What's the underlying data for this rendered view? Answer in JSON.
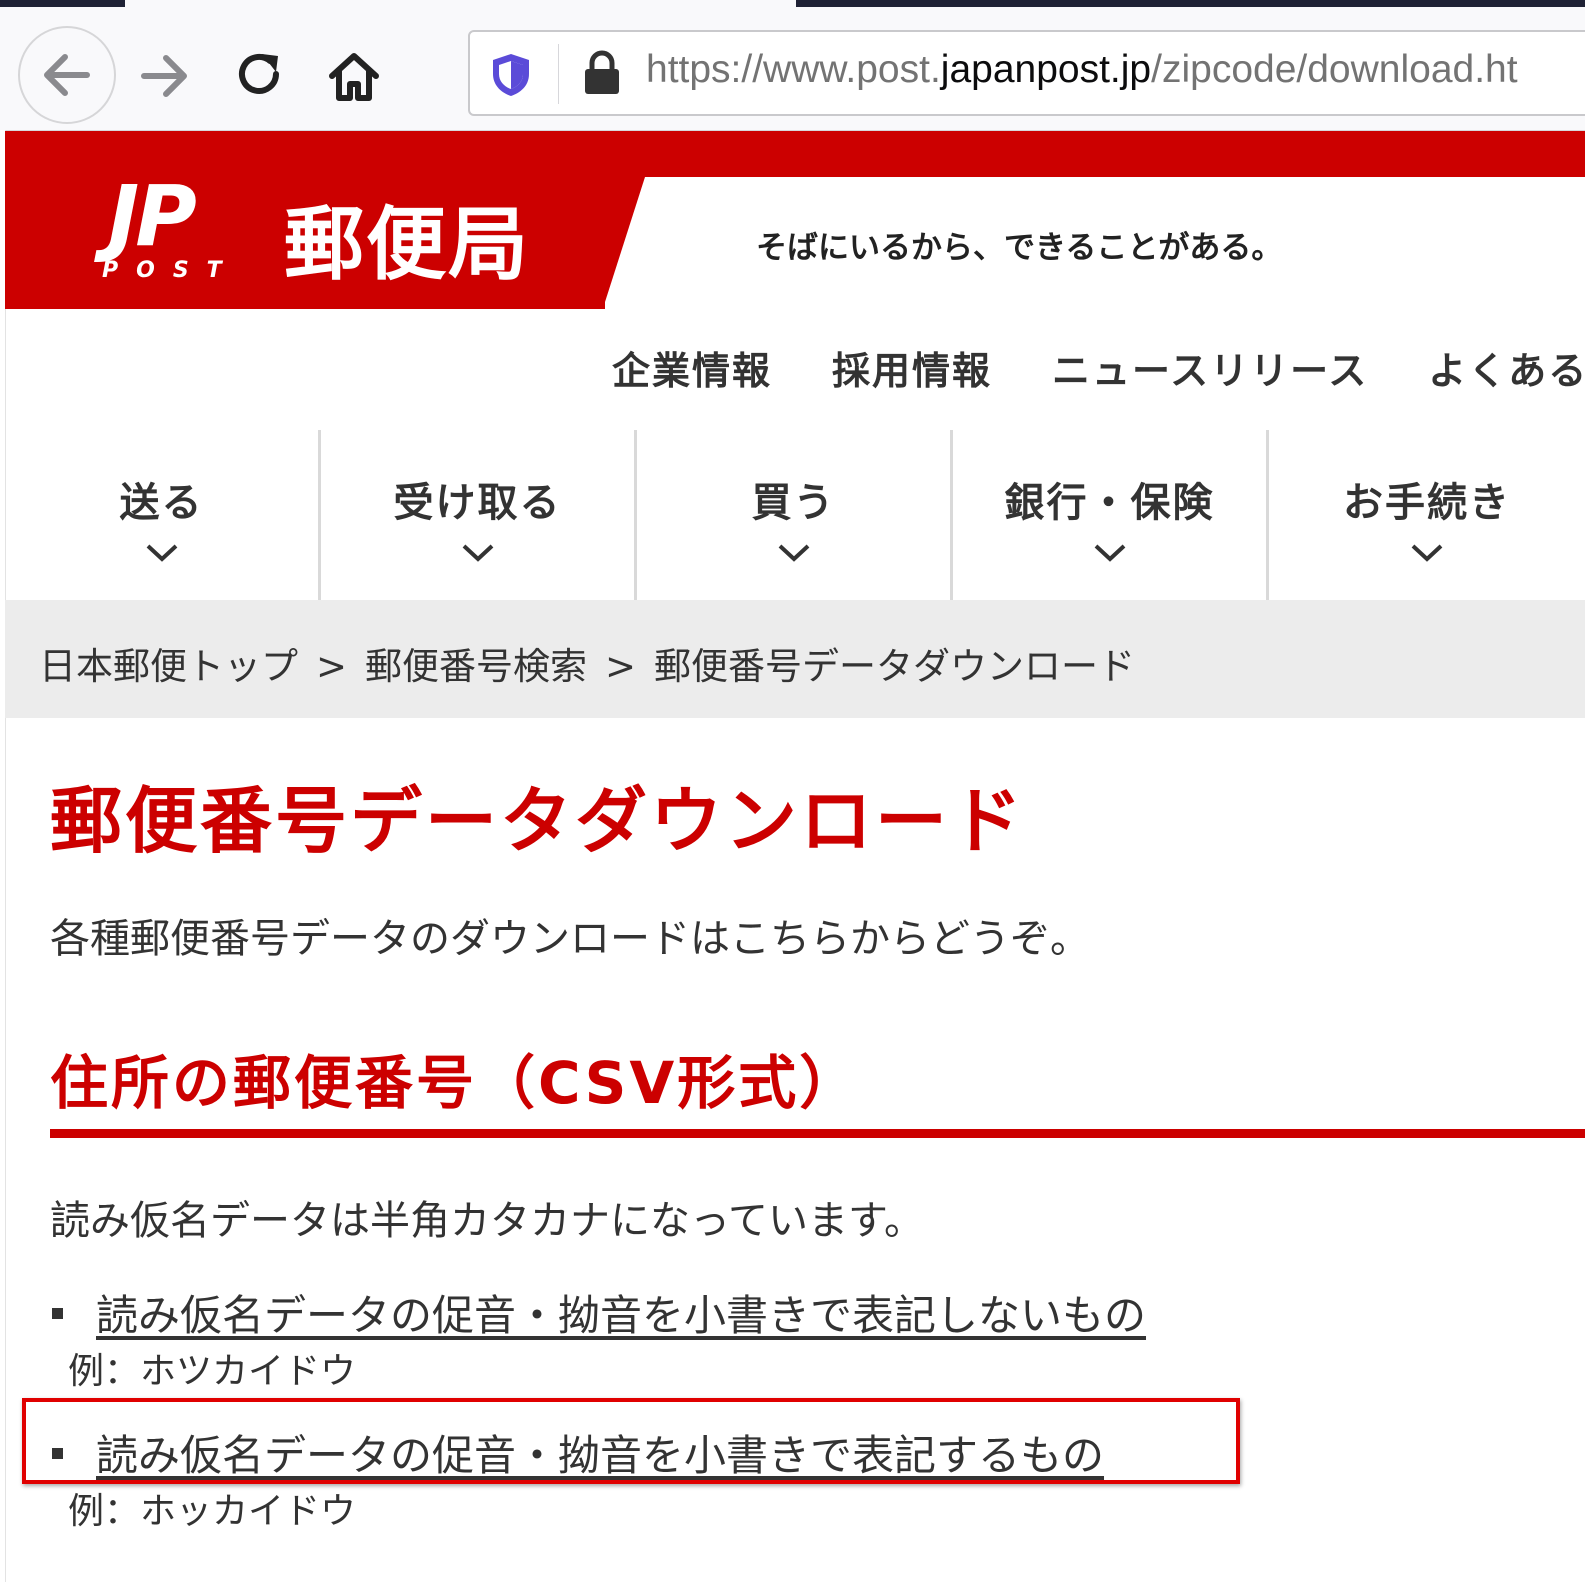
{
  "browser": {
    "url_prefix": "https://www.post.",
    "url_domain": "japanpost.jp",
    "url_suffix": "/zipcode/download.ht",
    "icons": [
      "back-icon",
      "forward-icon",
      "reload-icon",
      "home-icon",
      "tracking-shield-icon",
      "lock-icon"
    ]
  },
  "header": {
    "logo_jp": "JP",
    "logo_post": "POST",
    "logo_name": "郵便局",
    "tagline": "そばにいるから、できることがある。",
    "brand_color": "#cc0000"
  },
  "utility_nav": [
    "企業情報",
    "採用情報",
    "ニュースリリース",
    "よくあるご"
  ],
  "main_nav": [
    {
      "label": "送る"
    },
    {
      "label": "受け取る"
    },
    {
      "label": "買う"
    },
    {
      "label": "銀行・保険"
    },
    {
      "label": "お手続き"
    }
  ],
  "breadcrumb": {
    "items": [
      "日本郵便トップ",
      "郵便番号検索",
      "郵便番号データダウンロード"
    ],
    "separator": ">"
  },
  "main": {
    "title": "郵便番号データダウンロード",
    "intro": "各種郵便番号データのダウンロードはこちらからどうぞ。",
    "section_title": "住所の郵便番号（CSV形式）",
    "note": "読み仮名データは半角カタカナになっています。",
    "downloads": [
      {
        "link": "読み仮名データの促音・拗音を小書きで表記しないもの",
        "example": "例：ホツカイドウ"
      },
      {
        "link": "読み仮名データの促音・拗音を小書きで表記するもの",
        "example": "例：ホッカイドウ"
      }
    ]
  }
}
